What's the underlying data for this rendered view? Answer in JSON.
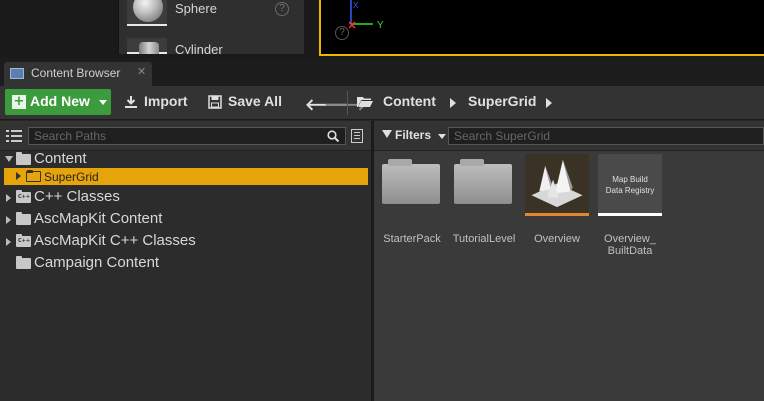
{
  "place_panel": {
    "items": [
      {
        "label": "Sphere"
      },
      {
        "label": "Cylinder"
      }
    ],
    "help_glyph": "?"
  },
  "viewport": {
    "axis_x": "X",
    "axis_y": "Y",
    "help_glyph": "?"
  },
  "tab": {
    "label": "Content Browser",
    "close_glyph": "✕"
  },
  "toolbar": {
    "add_new": "Add New",
    "import": "Import",
    "save_all": "Save All",
    "back_glyph": "🡐",
    "forward_glyph": "🡒",
    "breadcrumbs": [
      "Content",
      "SuperGrid"
    ]
  },
  "sources": {
    "search_placeholder": "Search Paths",
    "tree": [
      {
        "label": "Content",
        "expanded": true,
        "depth": 0
      },
      {
        "label": "SuperGrid",
        "selected": true,
        "depth": 1
      },
      {
        "label": "C++ Classes",
        "depth": 0,
        "type": "cpp"
      },
      {
        "label": "AscMapKit Content",
        "depth": 0
      },
      {
        "label": "AscMapKit C++ Classes",
        "depth": 0,
        "type": "cpp"
      },
      {
        "label": "Campaign Content",
        "depth": 0
      }
    ]
  },
  "assets": {
    "filters_label": "Filters",
    "search_placeholder": "Search SuperGrid",
    "items": [
      {
        "name": "StarterPack",
        "kind": "folder"
      },
      {
        "name": "TutorialLevel",
        "kind": "folder"
      },
      {
        "name": "Overview",
        "kind": "level",
        "accent": "#e0882a"
      },
      {
        "name": "Overview_\nBuiltData",
        "kind": "map-build-data",
        "thumb_text": "Map Build\nData Registry",
        "accent": "#ffffff"
      }
    ]
  },
  "colors": {
    "add_new_bg": "#3c9b3c",
    "selected_row": "#e5a50a",
    "viewport_border": "#e6b800"
  }
}
